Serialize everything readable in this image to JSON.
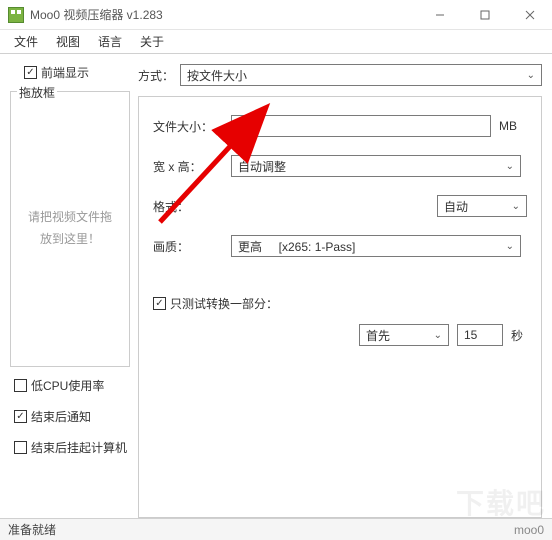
{
  "window": {
    "title": "Moo0 视频压缩器 v1.283"
  },
  "menus": [
    "文件",
    "视图",
    "语言",
    "关于"
  ],
  "left": {
    "front_display_label": "前端显示",
    "dropzone_title": "拖放框",
    "dropzone_text": "请把视频文件拖\n放到这里！",
    "low_cpu_label": "低CPU使用率",
    "notify_done_label": "结束后通知",
    "suspend_done_label": "结束后挂起计算机"
  },
  "mode": {
    "label": "方式：",
    "value": "按文件大小"
  },
  "form": {
    "filesize_label": "文件大小：",
    "filesize_value": "100",
    "filesize_unit": "MB",
    "wh_label": "宽 x 高：",
    "wh_value": "自动调整",
    "format_label": "格式：",
    "format_value": "自动",
    "quality_label": "画质：",
    "quality_value": "更高     [x265: 1-Pass]"
  },
  "test": {
    "only_test_label": "只测试转换一部分：",
    "first_label": "首先",
    "seconds_value": "15",
    "seconds_unit": "秒"
  },
  "status": {
    "ready": "准备就绪",
    "brand": "moo0"
  },
  "checks": {
    "front_display": true,
    "low_cpu": false,
    "notify_done": true,
    "suspend_done": false,
    "only_test": true
  },
  "colors": {
    "arrow": "#e60000"
  },
  "watermark": "下载吧"
}
